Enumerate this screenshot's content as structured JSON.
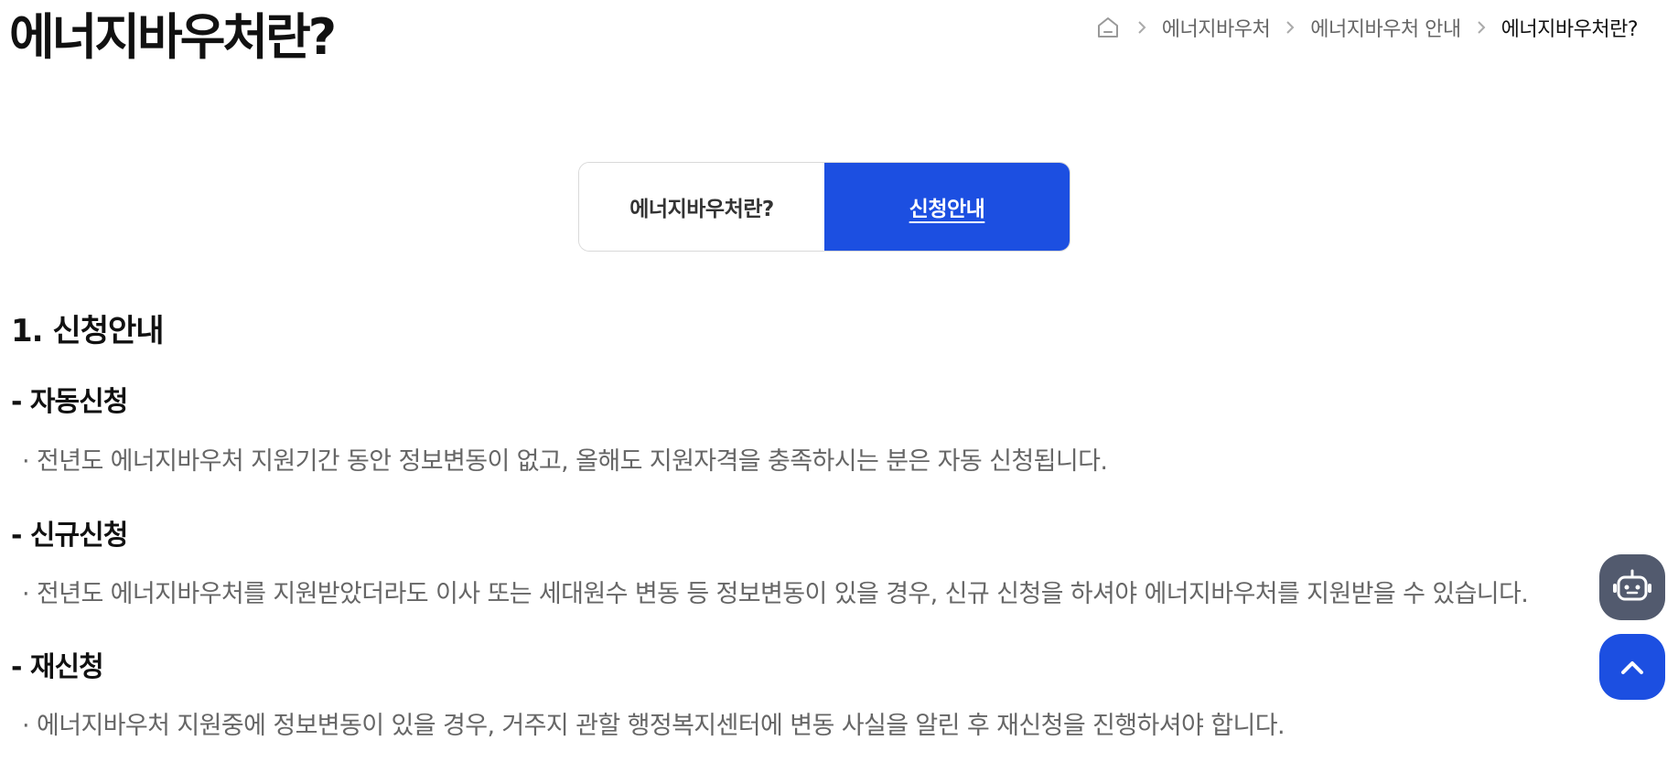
{
  "page": {
    "title": "에너지바우처란?"
  },
  "breadcrumb": {
    "home_icon": "home-icon",
    "separator_icon": "chevron-right-icon",
    "items": [
      "에너지바우처",
      "에너지바우처 안내",
      "에너지바우처란?"
    ]
  },
  "tabs": [
    {
      "label": "에너지바우처란?",
      "active": false
    },
    {
      "label": "신청안내",
      "active": true
    }
  ],
  "content": {
    "section_title": "1. 신청안내",
    "blocks": [
      {
        "heading": "- 자동신청",
        "text": "· 전년도 에너지바우처 지원기간 동안 정보변동이 없고, 올해도 지원자격을 충족하시는 분은 자동 신청됩니다."
      },
      {
        "heading": "- 신규신청",
        "text": "· 전년도 에너지바우처를 지원받았더라도 이사 또는 세대원수 변동 등 정보변동이 있을 경우, 신규 신청을 하셔야 에너지바우처를 지원받을 수 있습니다."
      },
      {
        "heading": "- 재신청",
        "text": "· 에너지바우처 지원중에 정보변동이 있을 경우, 거주지 관할 행정복지센터에 변동 사실을 알린 후 재신청을 진행하셔야 합니다."
      }
    ]
  },
  "floating": {
    "chatbot_icon": "robot-icon",
    "top_icon": "chevron-up-icon"
  },
  "colors": {
    "accent": "#1c4fe1",
    "chatbot_bg": "#525a6e",
    "body_text": "#666666"
  }
}
